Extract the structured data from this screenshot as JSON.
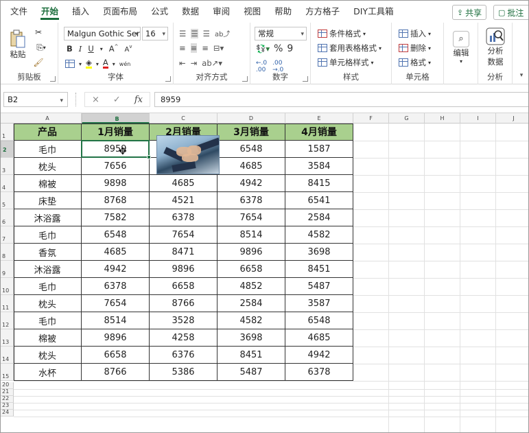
{
  "menu": {
    "tabs": [
      "文件",
      "开始",
      "插入",
      "页面布局",
      "公式",
      "数据",
      "审阅",
      "视图",
      "帮助",
      "方方格子",
      "DIY工具箱"
    ],
    "active_index": 1,
    "share_label": "共享",
    "comment_label": "批注"
  },
  "ribbon": {
    "clipboard": {
      "label": "剪贴板",
      "paste_label": "粘贴"
    },
    "font": {
      "label": "字体",
      "font_name": "Malgun Gothic Ser",
      "font_size": "16",
      "bold": "B",
      "italic": "I",
      "underline": "U",
      "grow": "A",
      "shrink": "A",
      "wen": "wén"
    },
    "alignment": {
      "label": "对齐方式"
    },
    "number": {
      "label": "数字",
      "format": "常规",
      "percent": "%",
      "comma": "9"
    },
    "styles": {
      "label": "样式",
      "cond_format": "条件格式",
      "table_format": "套用表格格式",
      "cell_styles": "单元格样式"
    },
    "cells": {
      "label": "单元格",
      "insert": "插入",
      "delete": "删除",
      "format": "格式"
    },
    "editing": {
      "label": "编辑"
    },
    "analysis": {
      "label": "分析",
      "analyze_data_line1": "分析",
      "analyze_data_line2": "数据"
    }
  },
  "formula_bar": {
    "name_box": "B2",
    "formula": "8959",
    "cancel": "×",
    "enter": "✓",
    "fx": "fx"
  },
  "sheet": {
    "columns": [
      "A",
      "B",
      "C",
      "D",
      "E",
      "F",
      "G",
      "H",
      "I",
      "J"
    ],
    "selected_column": "B",
    "selected_row": 2,
    "row_numbers": [
      1,
      2,
      3,
      4,
      5,
      6,
      7,
      8,
      9,
      10,
      11,
      12,
      13,
      14,
      15,
      20,
      21,
      22,
      23,
      24
    ],
    "table": {
      "headers": [
        "产品",
        "1月销量",
        "2月销量",
        "3月销量",
        "4月销量"
      ],
      "rows": [
        [
          "毛巾",
          "8959",
          "",
          "6548",
          "1587"
        ],
        [
          "枕头",
          "7656",
          "",
          "4685",
          "3584"
        ],
        [
          "棉被",
          "9898",
          "4685",
          "4942",
          "8415"
        ],
        [
          "床垫",
          "8768",
          "4521",
          "6378",
          "6541"
        ],
        [
          "沐浴露",
          "7582",
          "6378",
          "7654",
          "2584"
        ],
        [
          "毛巾",
          "6548",
          "7654",
          "8514",
          "4582"
        ],
        [
          "香氛",
          "4685",
          "8471",
          "9896",
          "3698"
        ],
        [
          "沐浴露",
          "4942",
          "9896",
          "6658",
          "8451"
        ],
        [
          "毛巾",
          "6378",
          "6658",
          "4852",
          "5487"
        ],
        [
          "枕头",
          "7654",
          "8766",
          "2584",
          "3587"
        ],
        [
          "毛巾",
          "8514",
          "3528",
          "4582",
          "6548"
        ],
        [
          "棉被",
          "9896",
          "4258",
          "3698",
          "4685"
        ],
        [
          "枕头",
          "6658",
          "6376",
          "8451",
          "4942"
        ],
        [
          "水杯",
          "8766",
          "5386",
          "5487",
          "6378"
        ]
      ]
    },
    "picture_icon": "teamwork-hands-photo"
  },
  "colors": {
    "header_fill": "#a9d08e",
    "accent": "#217346"
  }
}
